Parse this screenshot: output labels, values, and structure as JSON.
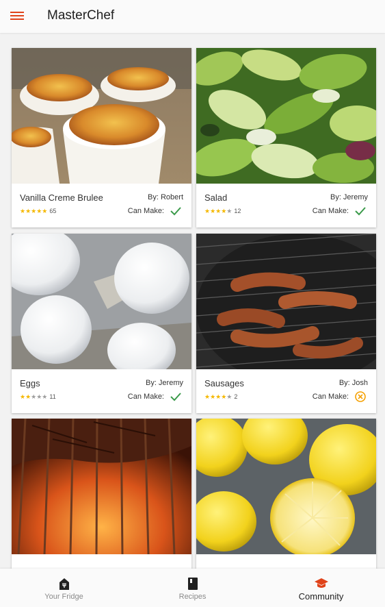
{
  "app": {
    "title": "MasterChef"
  },
  "colors": {
    "accent": "#e0431a",
    "star": "#f5b800",
    "check": "#3a9a4a",
    "cannot": "#f5a000"
  },
  "recipes": [
    {
      "name": "Vanilla Creme Brulee",
      "author": "By: Robert",
      "rating": 5,
      "rating_count": "65",
      "can_make_label": "Can Make:",
      "can_make": true
    },
    {
      "name": "Salad",
      "author": "By: Jeremy",
      "rating": 4,
      "rating_count": "12",
      "can_make_label": "Can Make:",
      "can_make": true
    },
    {
      "name": "Eggs",
      "author": "By: Jeremy",
      "rating": 2,
      "rating_count": "11",
      "can_make_label": "Can Make:",
      "can_make": true
    },
    {
      "name": "Sausages",
      "author": "By: Josh",
      "rating": 4.5,
      "rating_count": "2",
      "can_make_label": "Can Make:",
      "can_make": false
    },
    {
      "name": "",
      "author": "",
      "rating": null,
      "rating_count": "",
      "can_make_label": "",
      "can_make": null
    },
    {
      "name": "",
      "author": "",
      "rating": null,
      "rating_count": "",
      "can_make_label": "",
      "can_make": null
    }
  ],
  "nav": {
    "items": [
      {
        "label": "Your Fridge",
        "icon": "fridge-icon",
        "active": false
      },
      {
        "label": "Recipes",
        "icon": "book-icon",
        "active": false
      },
      {
        "label": "Community",
        "icon": "graduation-cap-icon",
        "active": true
      }
    ]
  }
}
